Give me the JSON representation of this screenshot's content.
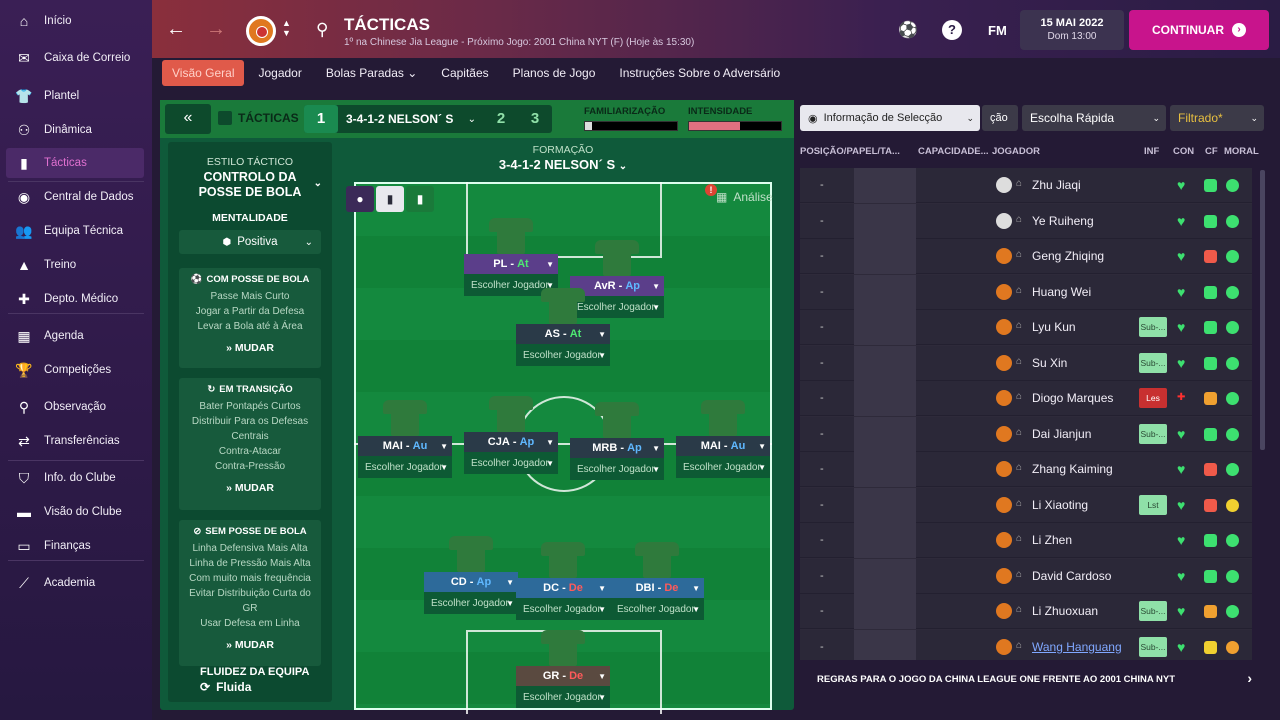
{
  "sidebar": {
    "items": [
      {
        "label": "Início",
        "icon": "home-icon",
        "glyph": "⌂"
      },
      {
        "label": "Caixa de Correio",
        "icon": "inbox-icon",
        "glyph": "✉"
      },
      {
        "label": "Plantel",
        "icon": "shirt-icon",
        "glyph": "👕"
      },
      {
        "label": "Dinâmica",
        "icon": "dynamics-icon",
        "glyph": "⚇"
      },
      {
        "label": "Tácticas",
        "icon": "tactics-icon",
        "glyph": "▮"
      },
      {
        "label": "Central de Dados",
        "icon": "data-icon",
        "glyph": "◉"
      },
      {
        "label": "Equipa Técnica",
        "icon": "staff-icon",
        "glyph": "👥"
      },
      {
        "label": "Treino",
        "icon": "training-icon",
        "glyph": "▲"
      },
      {
        "label": "Depto. Médico",
        "icon": "medical-icon",
        "glyph": "✚"
      },
      {
        "label": "Agenda",
        "icon": "calendar-icon",
        "glyph": "▦"
      },
      {
        "label": "Competições",
        "icon": "trophy-icon",
        "glyph": "🏆"
      },
      {
        "label": "Observação",
        "icon": "scouting-icon",
        "glyph": "⚲"
      },
      {
        "label": "Transferências",
        "icon": "transfers-icon",
        "glyph": "⇄"
      },
      {
        "label": "Info. do Clube",
        "icon": "club-info-icon",
        "glyph": "⛉"
      },
      {
        "label": "Visão do Clube",
        "icon": "club-vision-icon",
        "glyph": "▬"
      },
      {
        "label": "Finanças",
        "icon": "finances-icon",
        "glyph": "▭"
      },
      {
        "label": "Academia",
        "icon": "academy-icon",
        "glyph": "⟋"
      }
    ]
  },
  "header": {
    "title": "TÁCTICAS",
    "subtitle": "1º na Chinese Jia League - Próximo Jogo: 2001 China NYT (F) (Hoje às 15:30)",
    "fm": "FM",
    "help": "?",
    "date": "15 MAI 2022",
    "time": "Dom 13:00",
    "continue": "CONTINUAR"
  },
  "tabs": [
    {
      "label": "Visão Geral",
      "active": true
    },
    {
      "label": "Jogador"
    },
    {
      "label": "Bolas Paradas ⌄"
    },
    {
      "label": "Capitães"
    },
    {
      "label": "Planos de Jogo"
    },
    {
      "label": "Instruções Sobre o Adversário"
    }
  ],
  "tactics": {
    "label": "TÁCTICAS",
    "slot1": "1",
    "formation": "3-4-1-2 NELSON´ S",
    "slot2": "2",
    "slot3": "3",
    "familiarity_label": "FAMILIARIZAÇÃO",
    "intensity_label": "INTENSIDADE",
    "familiarity": 0.08,
    "intensity": 0.55
  },
  "style": {
    "heading": "ESTILO TÁCTICO",
    "title": "CONTROLO DA POSSE DE BOLA",
    "mentality_heading": "MENTALIDADE",
    "mentality": "Positiva",
    "in_possession": {
      "title": "COM POSSE DE BOLA",
      "lines": [
        "Passe Mais Curto",
        "Jogar a Partir da Defesa",
        "Levar a Bola até à Área"
      ],
      "change": "MUDAR"
    },
    "transition": {
      "title": "EM TRANSIÇÃO",
      "lines": [
        "Bater Pontapés Curtos",
        "Distribuir Para os Defesas",
        "Centrais",
        "Contra-Atacar",
        "Contra-Pressão"
      ],
      "change": "MUDAR"
    },
    "out_possession": {
      "title": "SEM POSSE DE BOLA",
      "lines": [
        "Linha Defensiva Mais Alta",
        "Linha de Pressão Mais Alta",
        "Com muito mais frequência",
        "Evitar Distribuição Curta do",
        "GR",
        "Usar Defesa em Linha"
      ],
      "change": "MUDAR"
    }
  },
  "pitch": {
    "heading": "FORMAÇÃO",
    "formation": "3-4-1-2 NELSON´ S",
    "analysis": "Análise",
    "warning": "!",
    "pick": "Escolher Jogador",
    "players": [
      {
        "pos": "PL",
        "duty": "At",
        "duty_class": "at",
        "color": "purple"
      },
      {
        "pos": "AvR",
        "duty": "Ap",
        "duty_class": "ap",
        "color": "purple"
      },
      {
        "pos": "AS",
        "duty": "At",
        "duty_class": "at",
        "color": "dark"
      },
      {
        "pos": "MAI",
        "duty": "Au",
        "duty_class": "ap",
        "color": "dark"
      },
      {
        "pos": "CJA",
        "duty": "Ap",
        "duty_class": "ap",
        "color": "dark"
      },
      {
        "pos": "MRB",
        "duty": "Ap",
        "duty_class": "ap",
        "color": "dark"
      },
      {
        "pos": "MAI",
        "duty": "Au",
        "duty_class": "ap",
        "color": "dark"
      },
      {
        "pos": "CD",
        "duty": "Ap",
        "duty_class": "ap",
        "color": "blue"
      },
      {
        "pos": "DC",
        "duty": "De",
        "duty_class": "de",
        "color": "blue"
      },
      {
        "pos": "DBI",
        "duty": "De",
        "duty_class": "de",
        "color": "blue"
      },
      {
        "pos": "GR",
        "duty": "De",
        "duty_class": "de",
        "color": "brown"
      }
    ],
    "fluidity_label": "FLUIDEZ DA EQUIPA",
    "fluidity": "Fluida"
  },
  "right": {
    "info_selection": "Informação de Selecção",
    "hidden_option": "ção",
    "quick_pick": "Escolha Rápida",
    "filtered": "Filtrado*",
    "columns": {
      "position": "POSIÇÃO/PAPEL/TA...",
      "ability": "CAPACIDADE...",
      "player": "JOGADOR",
      "inf": "INF",
      "con": "CON",
      "cf": "CF",
      "moral": "MORAL"
    },
    "players": [
      {
        "name": "Zhu Jiaqi",
        "shirt": "white",
        "tag": "",
        "heart": "green",
        "cf": "#3de070",
        "moral": "#3de070",
        "dash": "-"
      },
      {
        "name": "Ye Ruiheng",
        "shirt": "white",
        "tag": "",
        "heart": "green",
        "cf": "#3de070",
        "moral": "#3de070",
        "dash": "-"
      },
      {
        "name": "Geng Zhiqing",
        "shirt": "orange",
        "tag": "",
        "heart": "green",
        "cf": "#f05a4a",
        "moral": "#3de070",
        "dash": "-"
      },
      {
        "name": "Huang Wei",
        "shirt": "orange",
        "tag": "",
        "heart": "green",
        "cf": "#3de070",
        "moral": "#3de070",
        "dash": "-"
      },
      {
        "name": "Lyu Kun",
        "shirt": "orange",
        "tag": "Sub-...",
        "heart": "green",
        "cf": "#3de070",
        "moral": "#3de070",
        "dash": "-"
      },
      {
        "name": "Su Xin",
        "shirt": "orange",
        "tag": "Sub-...",
        "heart": "green",
        "cf": "#3de070",
        "moral": "#3de070",
        "dash": "-"
      },
      {
        "name": "Diogo Marques",
        "shirt": "orange",
        "tag": "Les",
        "tag_red": true,
        "heart": "red",
        "cf": "#f0a030",
        "moral": "#3de070",
        "dash": "-"
      },
      {
        "name": "Dai Jianjun",
        "shirt": "orange",
        "tag": "Sub-...",
        "heart": "green",
        "cf": "#3de070",
        "moral": "#3de070",
        "dash": "-"
      },
      {
        "name": "Zhang Kaiming",
        "shirt": "orange",
        "tag": "",
        "heart": "green",
        "cf": "#f05a4a",
        "moral": "#3de070",
        "dash": "-"
      },
      {
        "name": "Li Xiaoting",
        "shirt": "orange",
        "tag": "Lst",
        "heart": "green",
        "cf": "#f05a4a",
        "moral": "#f0d030",
        "dash": "-"
      },
      {
        "name": "Li Zhen",
        "shirt": "orange",
        "tag": "",
        "heart": "green",
        "cf": "#3de070",
        "moral": "#3de070",
        "dash": "-"
      },
      {
        "name": "David Cardoso",
        "shirt": "orange",
        "tag": "",
        "heart": "green",
        "cf": "#3de070",
        "moral": "#3de070",
        "dash": "-"
      },
      {
        "name": "Li Zhuoxuan",
        "shirt": "orange",
        "tag": "Sub-...",
        "heart": "green",
        "cf": "#f0a030",
        "moral": "#3de070",
        "dash": "-"
      },
      {
        "name": "Wang Hanguang",
        "shirt": "orange",
        "tag": "Sub-...",
        "heart": "green",
        "cf": "#f0d030",
        "moral": "#f0a030",
        "link": true,
        "dash": "-"
      }
    ],
    "rules": "REGRAS PARA O JOGO DA CHINA LEAGUE ONE FRENTE AO 2001 CHINA NYT"
  }
}
